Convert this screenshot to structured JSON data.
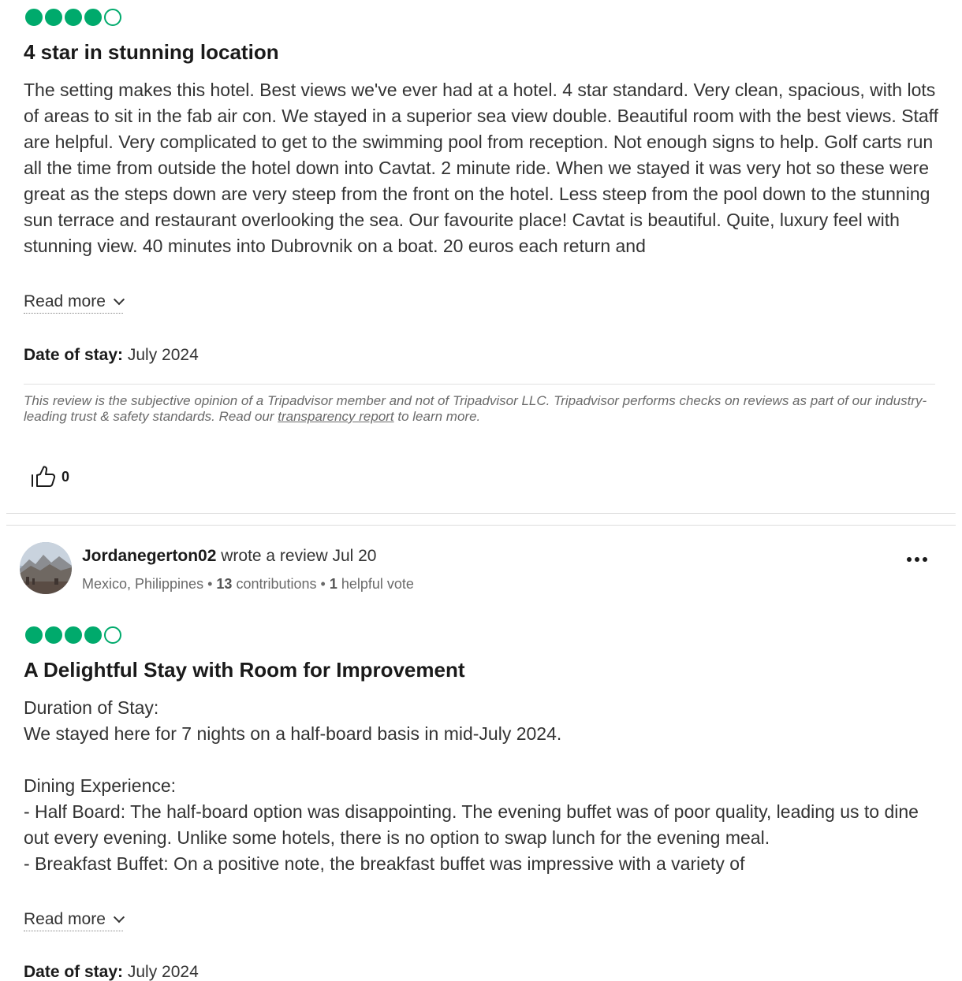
{
  "review1": {
    "rating": 4,
    "title": "4 star in stunning location",
    "body": "The setting makes this hotel. Best views we've ever had at a hotel. 4 star standard. Very clean, spacious, with lots of areas to sit in the fab air con. We stayed in a superior sea view double. Beautiful room with the best views. Staff are helpful. Very complicated to get to the swimming pool from reception. Not enough signs to help. Golf carts run all the time from outside the hotel down into Cavtat. 2 minute ride. When we stayed it was very hot so these were great as the steps down are very steep from the front on the hotel. Less steep from the pool down to the stunning sun terrace and restaurant overlooking the sea. Our favourite place! Cavtat is beautiful. Quite, luxury feel with stunning view. 40 minutes into Dubrovnik on a boat. 20 euros each return and",
    "read_more": "Read more",
    "date_label": "Date of stay:",
    "date_value": "July 2024",
    "disclaimer_pre": "This review is the subjective opinion of a Tripadvisor member and not of Tripadvisor LLC. Tripadvisor performs checks on reviews as part of our industry-leading trust & safety standards. Read our ",
    "disclaimer_link": "transparency report",
    "disclaimer_post": " to learn more.",
    "helpful_count": "0"
  },
  "review2": {
    "author": "Jordanegerton02",
    "wrote": "wrote a review Jul 20",
    "location": "Mexico, Philippines",
    "contributions_count": "13",
    "contributions_label": "contributions",
    "helpful_count": "1",
    "helpful_label": "helpful vote",
    "rating": 4,
    "title": "A Delightful Stay with Room for Improvement",
    "body": "Duration of Stay:\nWe stayed here for 7 nights on a half-board basis in mid-July 2024.\n\nDining Experience:\n- Half Board: The half-board option was disappointing. The evening buffet was of poor quality, leading us to dine out every evening. Unlike some hotels, there is no option to swap lunch for the evening meal.\n- Breakfast Buffet: On a positive note, the breakfast buffet was impressive with a variety of",
    "read_more": "Read more",
    "date_label": "Date of stay:",
    "date_value": "July 2024"
  },
  "colors": {
    "bubble_green": "#00aa6c",
    "text_primary": "#1a1a1a",
    "text_secondary": "#6a6a6a"
  },
  "icons": {
    "helpful": "thumbs-up-icon",
    "more": "more-dots-icon",
    "read_more": "chevron-down-icon"
  }
}
